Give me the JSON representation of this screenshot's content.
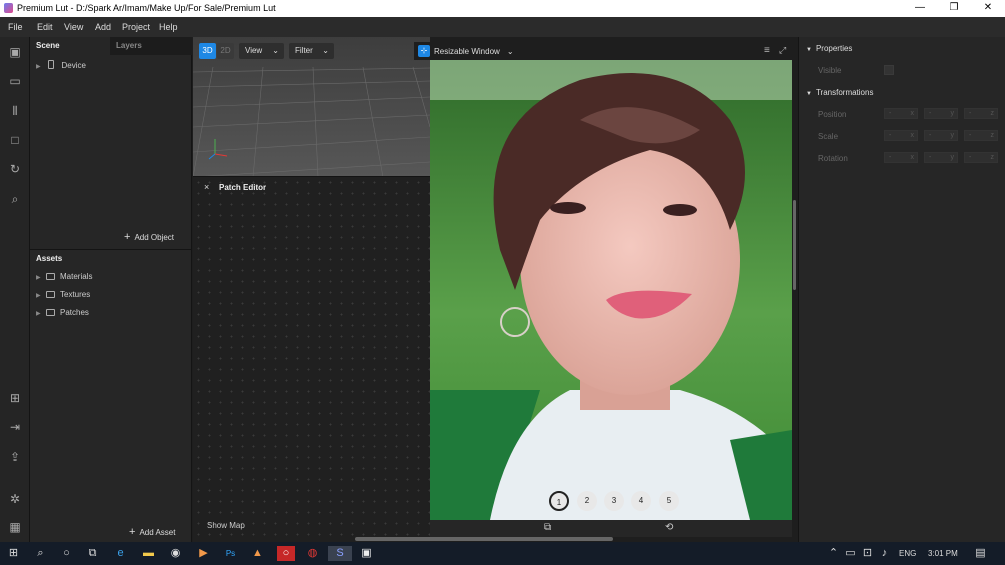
{
  "window": {
    "title": "Premium Lut - D:/Spark Ar/Imam/Make Up/For Sale/Premium Lut",
    "minimize": "—",
    "maximize": "❐",
    "close": "✕"
  },
  "menu": [
    "File",
    "Edit",
    "View",
    "Add",
    "Project",
    "Help"
  ],
  "scene": {
    "tab_scene": "Scene",
    "tab_layers": "Layers",
    "device": "Device",
    "add_object": "Add Object"
  },
  "assets": {
    "title": "Assets",
    "items": [
      "Materials",
      "Textures",
      "Patches"
    ],
    "add_asset": "Add Asset"
  },
  "viewport": {
    "mode_3d": "3D",
    "mode_2d": "2D",
    "view": "View",
    "filter": "Filter"
  },
  "patch": {
    "title": "Patch Editor",
    "close": "×",
    "show_map": "Show Map"
  },
  "simulator": {
    "window_mode": "Resizable Window",
    "dots": [
      "1",
      "2",
      "3",
      "4",
      "5"
    ],
    "active_dot": "1"
  },
  "properties": {
    "title": "Properties",
    "visible": "Visible",
    "transformations": "Transformations",
    "rows": [
      "Position",
      "Scale",
      "Rotation"
    ]
  },
  "taskbar": {
    "lang": "ENG",
    "time": "3:01 PM"
  },
  "colors": {
    "accent": "#1e88e5",
    "background": "#1e1e1e",
    "panel": "#262626"
  }
}
